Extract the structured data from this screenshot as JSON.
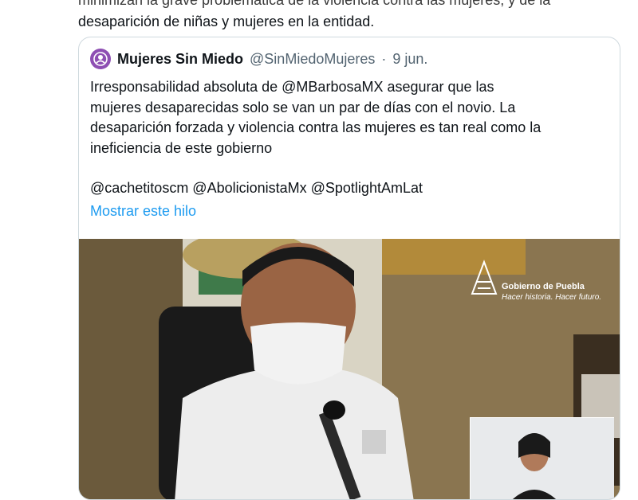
{
  "tweet": {
    "text_line1": "minimizan la grave problemática de la violencia contra las mujeres, y de la",
    "text_line2": "desaparición de niñas y mujeres en la entidad."
  },
  "quoted_tweet": {
    "display_name": "Mujeres Sin Miedo",
    "handle": "@SinMiedoMujeres",
    "separator": "·",
    "date": "9 jun.",
    "body_lines": [
      "Irresponsabilidad absoluta de @MBarbosaMX asegurar que las",
      "mujeres desaparecidas solo se van un par de días con el novio. La",
      "desaparición forzada y violencia contra las mujeres es tan real como la",
      "ineficiencia de este gobierno"
    ],
    "mentions": "@cachetitoscm @AbolicionistaMx @SpotlightAmLat",
    "show_thread": "Mostrar este hilo",
    "avatar_color": "#8e4fb3"
  },
  "media": {
    "overlay_title": "Gobierno de Puebla",
    "overlay_slogan": "Hacer historia. Hacer futuro.",
    "mask_text": "Hacer historia"
  },
  "colors": {
    "link": "#1d9bf0",
    "border": "#cfd9de",
    "muted": "#536471"
  }
}
